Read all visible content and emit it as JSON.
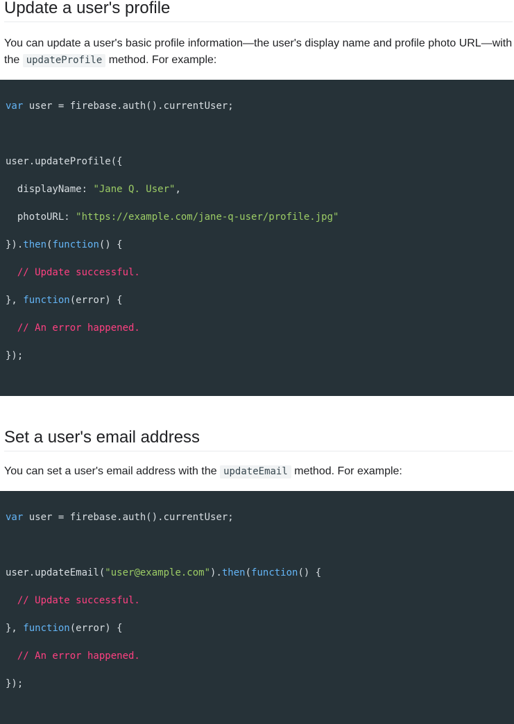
{
  "section_profile": {
    "heading": "Update a user's profile",
    "desc_before": "You can update a user's basic profile information—the user's display name and profile photo URL—with the ",
    "desc_code": "updateProfile",
    "desc_after": " method. For example:",
    "code": {
      "l1": {
        "kw": "var",
        "rest": " user = firebase.auth().currentUser;"
      },
      "l3": "user.updateProfile({",
      "l4": {
        "key": "  displayName: ",
        "str": "\"Jane Q. User\"",
        "end": ","
      },
      "l5": {
        "key": "  photoURL: ",
        "str": "\"https://example.com/jane-q-user/profile.jpg\""
      },
      "l6": {
        "pre": "}).",
        "kw1": "then",
        "mid": "(",
        "kw2": "function",
        "end": "() {"
      },
      "l7": "  // Update successful.",
      "l8": {
        "pre": "}, ",
        "kw": "function",
        "end": "(error) {"
      },
      "l9": "  // An error happened.",
      "l10": "});"
    }
  },
  "section_email": {
    "heading": "Set a user's email address",
    "desc_before": "You can set a user's email address with the ",
    "desc_code": "updateEmail",
    "desc_after": " method. For example:",
    "code": {
      "l1": {
        "kw": "var",
        "rest": " user = firebase.auth().currentUser;"
      },
      "l3": {
        "pre": "user.updateEmail(",
        "str": "\"user@example.com\"",
        "mid": ").",
        "kw1": "then",
        "mid2": "(",
        "kw2": "function",
        "end": "() {"
      },
      "l4": "  // Update successful.",
      "l5": {
        "pre": "}, ",
        "kw": "function",
        "end": "(error) {"
      },
      "l6": "  // An error happened.",
      "l7": "});"
    }
  },
  "colors": {
    "code_bg": "#263238",
    "keyword": "#64b5f6",
    "string": "#9ccc65",
    "comment": "#ff4081"
  }
}
